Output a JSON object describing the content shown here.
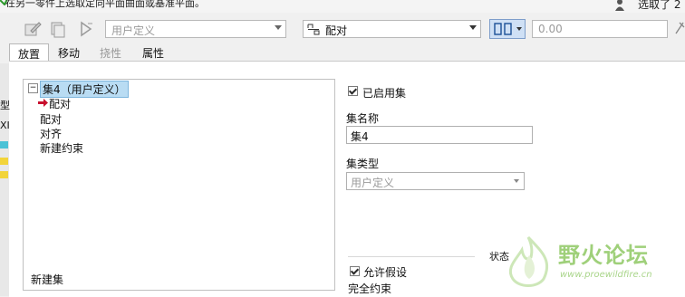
{
  "message": "在另一零件上选取定向平面曲面或基准平面。",
  "selected_text": "选取了 2",
  "toolbar": {
    "type_dropdown_value": "用户定义",
    "constraint_dropdown_value": "配对",
    "offset_placeholder": "0.00"
  },
  "tabs": [
    {
      "label": "放置"
    },
    {
      "label": "移动"
    },
    {
      "label": "挠性"
    },
    {
      "label": "属性"
    }
  ],
  "tree": {
    "set_label": "集4（用户定义）",
    "items": [
      "配对",
      "配对",
      "对齐",
      "新建约束"
    ],
    "new_set": "新建集"
  },
  "left_edge_fragments": [
    "型",
    "XI"
  ],
  "props": {
    "enable_set_label": "已启用集",
    "enable_set_checked": true,
    "set_name_label": "集名称",
    "set_name_value": "集4",
    "set_type_label": "集类型",
    "set_type_value": "用户定义",
    "status_label": "状态",
    "allow_assumptions_label": "允许假设",
    "allow_assumptions_checked": true,
    "status_value": "完全约束"
  },
  "watermark": {
    "title": "野火论坛",
    "url": "www.proewildfire.cn"
  },
  "colors": {
    "selection": "#b9dcf3",
    "arrow_red": "#c8102e",
    "watermark_green": "#9fd07a"
  }
}
